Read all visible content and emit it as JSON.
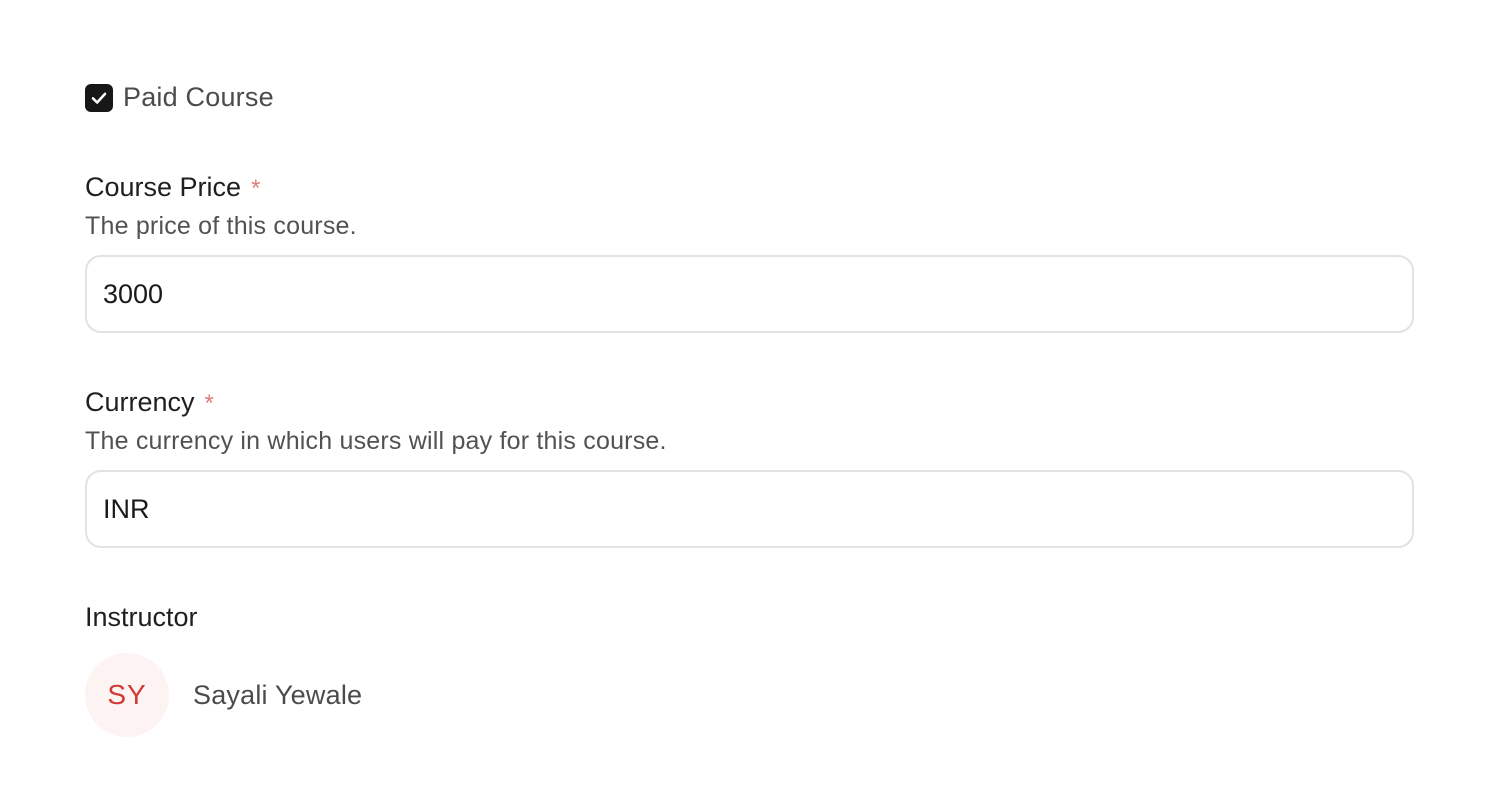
{
  "paid_course": {
    "label": "Paid Course",
    "checked": true
  },
  "course_price": {
    "label": "Course Price",
    "required_mark": "*",
    "description": "The price of this course.",
    "value": "3000"
  },
  "currency": {
    "label": "Currency",
    "required_mark": "*",
    "description": "The currency in which users will pay for this course.",
    "value": "INR"
  },
  "instructor": {
    "title": "Instructor",
    "initials": "SY",
    "name": "Sayali Yewale"
  },
  "icons": {
    "checkbox": "check-icon"
  },
  "colors": {
    "checkbox_bg": "#171717",
    "required": "#e07a7a",
    "avatar_bg": "#fcf3f2",
    "avatar_text": "#d13b36"
  }
}
